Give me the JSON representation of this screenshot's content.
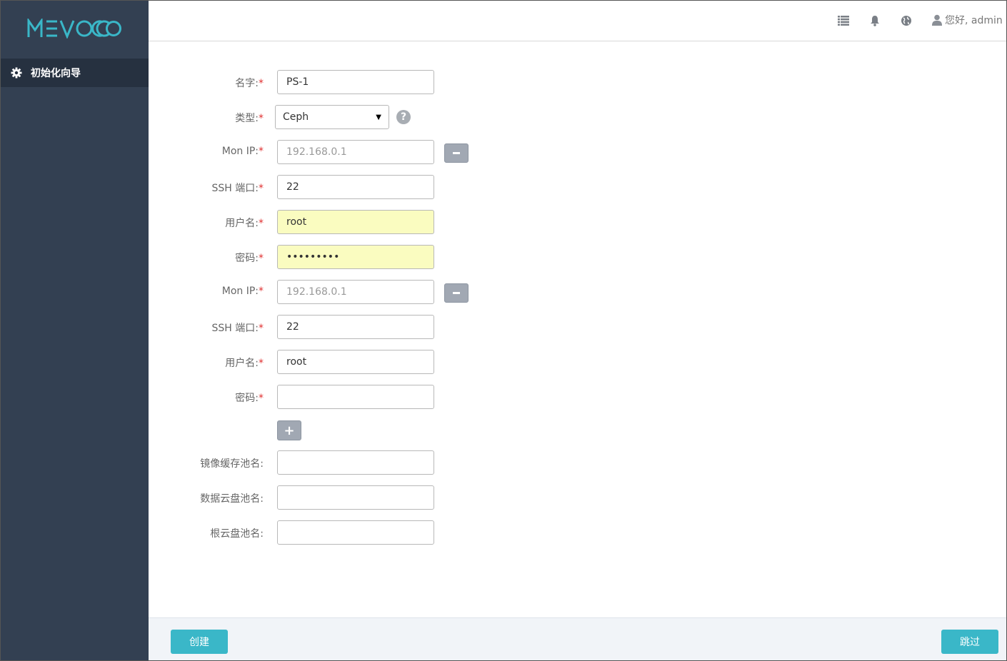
{
  "app": {
    "logo_text": "MEVOCO",
    "brand_color": "#3ab7c8"
  },
  "sidebar": {
    "items": [
      {
        "label": "初始化向导",
        "icon": "gear-icon"
      }
    ]
  },
  "header": {
    "icons": [
      "list-icon",
      "bell-icon",
      "globe-icon"
    ],
    "user_label": "您好, admin"
  },
  "form": {
    "name": {
      "label": "名字:",
      "value": "PS-1"
    },
    "type": {
      "label": "类型:",
      "value": "Ceph",
      "help": "?"
    },
    "mons": [
      {
        "ip": {
          "label": "Mon IP:",
          "value": "",
          "placeholder": "192.168.0.1"
        },
        "port": {
          "label": "SSH 端口:",
          "value": "22"
        },
        "user": {
          "label": "用户名:",
          "value": "root"
        },
        "password": {
          "label": "密码:",
          "value": "•••••••••"
        }
      },
      {
        "ip": {
          "label": "Mon IP:",
          "value": "",
          "placeholder": "192.168.0.1"
        },
        "port": {
          "label": "SSH 端口:",
          "value": "22"
        },
        "user": {
          "label": "用户名:",
          "value": "root"
        },
        "password": {
          "label": "密码:",
          "value": ""
        }
      }
    ],
    "image_cache_pool": {
      "label": "镜像缓存池名:",
      "value": ""
    },
    "data_volume_pool": {
      "label": "数据云盘池名:",
      "value": ""
    },
    "root_volume_pool": {
      "label": "根云盘池名:",
      "value": ""
    },
    "required_mark": "*"
  },
  "footer": {
    "create_label": "创建",
    "skip_label": "跳过"
  }
}
